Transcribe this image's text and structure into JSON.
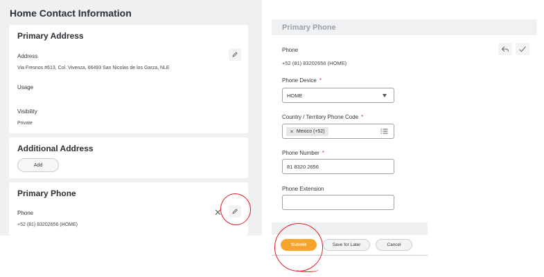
{
  "left": {
    "title": "Home Contact Information",
    "primary_address": {
      "title": "Primary Address",
      "address_label": "Address",
      "address_value": "Via Fresnos #613, Col. Vivenza, 66493 San Nicolas de los Garza, NLE",
      "usage_label": "Usage",
      "visibility_label": "Visibility",
      "visibility_value": "Private"
    },
    "additional_address": {
      "title": "Additional Address",
      "add_label": "Add"
    },
    "primary_phone": {
      "title": "Primary Phone",
      "phone_label": "Phone",
      "phone_value": "+52 (81) 83202656 (HOME)"
    }
  },
  "right": {
    "header_title": "Primary Phone",
    "phone_label": "Phone",
    "phone_value": "+52 (81) 83202656 (HOME)",
    "device_label": "Phone Device",
    "device_value": "HOME",
    "country_label": "Country / Territory Phone Code",
    "country_value": "Mexico (+52)",
    "number_label": "Phone Number",
    "number_value": "81 8320 2656",
    "extension_label": "Phone Extension",
    "extension_value": "",
    "required_mark": "*"
  },
  "footer": {
    "submit_label": "Submit",
    "save_later_label": "Save for Later",
    "cancel_label": "Cancel"
  },
  "colors": {
    "panel_bg": "#eef0f2",
    "submit_orange": "#f7a42b",
    "required_red": "#e0352b",
    "annotation_red": "#e0202a"
  },
  "icons": [
    "edit-pencil-icon",
    "close-icon",
    "undo-icon",
    "checkmark-icon",
    "dropdown-arrow-icon",
    "prompt-list-icon",
    "remove-x-icon"
  ]
}
